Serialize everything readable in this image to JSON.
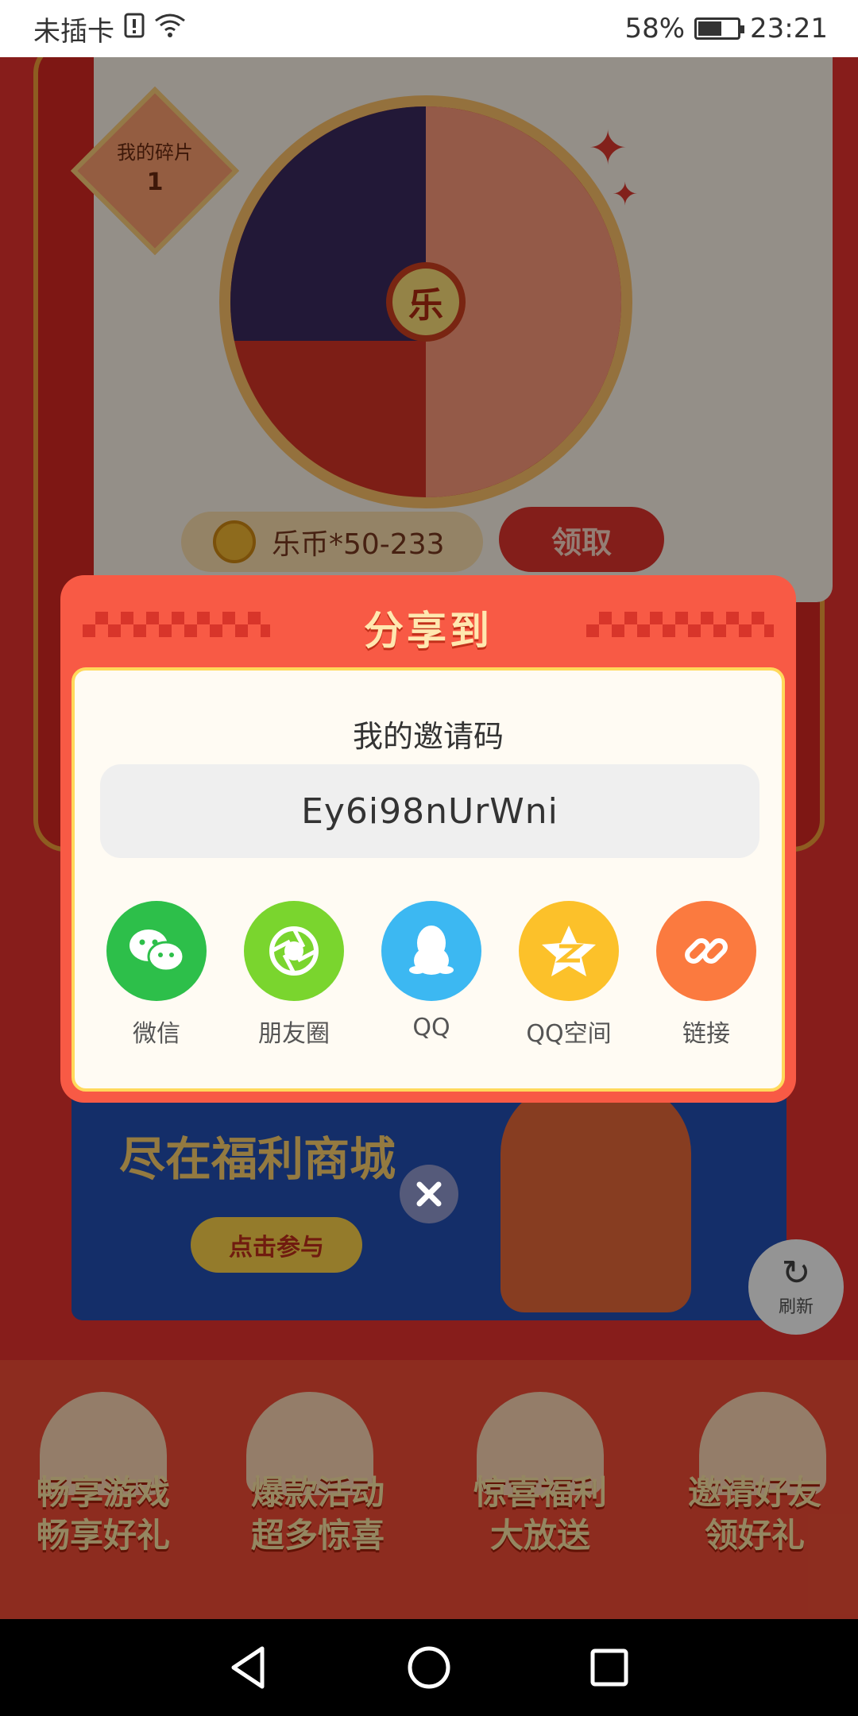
{
  "status_bar": {
    "carrier": "未插卡",
    "battery_percent": "58%",
    "time": "23:21",
    "icons": [
      "sim-alert-icon",
      "wifi-icon",
      "battery-charging-icon"
    ]
  },
  "background": {
    "fragments_label": "我的碎片",
    "fragments_count": "1",
    "wheel_center": "乐",
    "coin_reward": "乐币*50-233",
    "claim_button": "领取",
    "mall_banner_text": "尽在福利商城",
    "mall_button": "点击参与",
    "refresh_label": "刷新",
    "promos": [
      {
        "line1": "畅享游戏",
        "line2": "畅享好礼"
      },
      {
        "line1": "爆款活动",
        "line2": "超多惊喜"
      },
      {
        "line1": "惊喜福利",
        "line2": "大放送"
      },
      {
        "line1": "邀请好友",
        "line2": "领好礼"
      }
    ]
  },
  "dialog": {
    "title": "分享到",
    "invite_label": "我的邀请码",
    "invite_code": "Ey6i98nUrWni",
    "share_options": [
      {
        "label": "微信",
        "icon": "wechat-icon",
        "color": "#2dbf4a"
      },
      {
        "label": "朋友圈",
        "icon": "moments-icon",
        "color": "#7ad52e"
      },
      {
        "label": "QQ",
        "icon": "qq-icon",
        "color": "#3cb8f2"
      },
      {
        "label": "QQ空间",
        "icon": "qzone-icon",
        "color": "#fcc12a"
      },
      {
        "label": "链接",
        "icon": "link-icon",
        "color": "#fb7a3f"
      }
    ]
  },
  "nav_bar": {
    "buttons": [
      "back-icon",
      "home-icon",
      "recents-icon"
    ]
  },
  "colors": {
    "dialog_red": "#f85a45",
    "dialog_title": "#ffe8b0",
    "page_red": "#e9322f"
  }
}
